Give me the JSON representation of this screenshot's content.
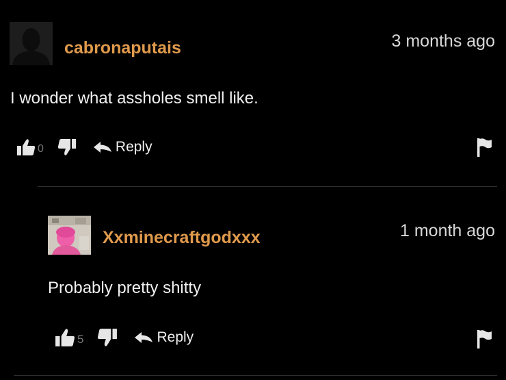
{
  "comments": [
    {
      "username": "cabronaputais",
      "timestamp": "3 months ago",
      "text": "I wonder what assholes smell like.",
      "likes": "0",
      "reply_label": "Reply",
      "avatar": "default-silhouette-avatar"
    },
    {
      "username": "Xxminecraftgodxxx",
      "timestamp": "1 month ago",
      "text": "Probably pretty shitty",
      "likes": "5",
      "reply_label": "Reply",
      "avatar": "photo-avatar-pink"
    }
  ],
  "icons": {
    "like": "thumbs-up-icon",
    "dislike": "thumbs-down-icon",
    "reply": "reply-arrow-icon",
    "flag": "flag-icon"
  },
  "colors": {
    "background": "#000000",
    "username": "#e09a4c",
    "text": "#f0f0f0",
    "count": "#777777",
    "divider": "#2e2e2e"
  }
}
